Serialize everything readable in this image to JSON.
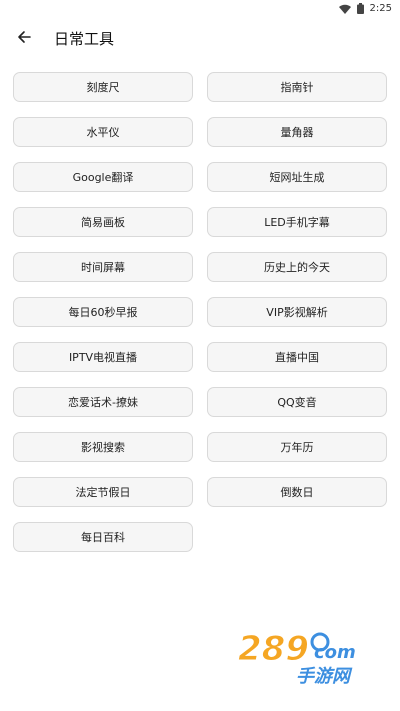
{
  "status": {
    "wifi_icon": "wifi-icon",
    "battery_icon": "battery-icon",
    "time": "2:25"
  },
  "app_bar": {
    "back_icon": "arrow-left-icon",
    "title": "日常工具"
  },
  "tools": [
    {
      "label": "刻度尺"
    },
    {
      "label": "指南针"
    },
    {
      "label": "水平仪"
    },
    {
      "label": "量角器"
    },
    {
      "label": "Google翻译"
    },
    {
      "label": "短网址生成"
    },
    {
      "label": "简易画板"
    },
    {
      "label": "LED手机字幕"
    },
    {
      "label": "时间屏幕"
    },
    {
      "label": "历史上的今天"
    },
    {
      "label": "每日60秒早报"
    },
    {
      "label": "VIP影视解析"
    },
    {
      "label": "IPTV电视直播"
    },
    {
      "label": "直播中国"
    },
    {
      "label": "恋爱话术-撩妹"
    },
    {
      "label": "QQ变音"
    },
    {
      "label": "影视搜索"
    },
    {
      "label": "万年历"
    },
    {
      "label": "法定节假日"
    },
    {
      "label": "倒数日"
    },
    {
      "label": "每日百科"
    }
  ],
  "watermark": {
    "number": "289",
    "domain": "com",
    "tagline": "手游网"
  },
  "colors": {
    "button_bg": "#f6f6f6",
    "button_border": "#d9d9d9",
    "watermark_orange": "#f5a623",
    "watermark_blue": "#3d8fe0"
  }
}
